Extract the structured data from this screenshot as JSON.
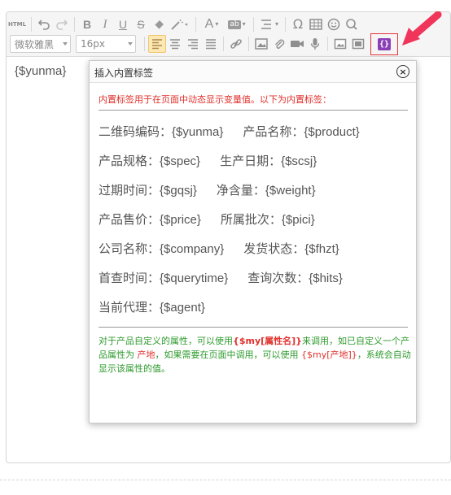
{
  "toolbar": {
    "html_label": "HTML",
    "font_family": "微软雅黑",
    "font_size": "16px",
    "insert_tag_label": "{}"
  },
  "editor": {
    "content": "{$yunma}"
  },
  "dialog": {
    "title": "插入内置标签",
    "close_symbol": "×",
    "intro": "内置标签用于在页面中动态显示变量值。以下为内置标签：",
    "rows": [
      [
        "二维码编码：{$yunma}",
        "产品名称：{$product}"
      ],
      [
        "产品规格：{$spec}",
        "生产日期：{$scsj}"
      ],
      [
        "过期时间：{$gqsj}",
        "净含量：{$weight}"
      ],
      [
        "产品售价：{$price}",
        "所属批次：{$pici}"
      ],
      [
        "公司名称：{$company}",
        "发货状态：{$fhzt}"
      ],
      [
        "首查时间：{$querytime}",
        "查询次数：{$hits}"
      ],
      [
        "当前代理：{$agent}",
        ""
      ]
    ],
    "note": {
      "p1": "对于产品自定义的属性，可以使用",
      "c1": "{$my[属性名]}",
      "p2": "来调用，如已自定义一个产品属性为 ",
      "c2": "产地",
      "p3": "，如果需要在页面中调用，可以使用 ",
      "c3": "{$my[产地]}",
      "p4": "，系统会自动显示该属性的值。"
    }
  },
  "colors": {
    "accent_red": "#e8343c",
    "intro_red": "#e0312c",
    "note_green": "#2e9a2e",
    "tag_purple": "#8a3fb5"
  }
}
